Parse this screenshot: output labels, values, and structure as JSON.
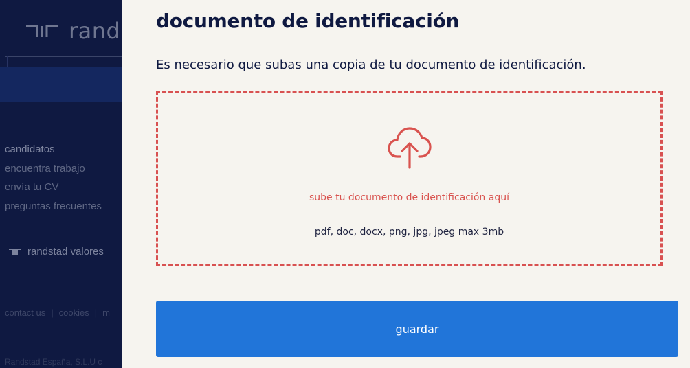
{
  "background": {
    "brand": "rand",
    "nav_heading": "candidatos",
    "nav_items": [
      "encuentra trabajo",
      "envía tu CV",
      "preguntas frecuentes"
    ],
    "valores": "randstad valores",
    "footer_links": [
      "contact us",
      "cookies",
      "m"
    ],
    "copyright": "Randstad España, S.L.U c"
  },
  "modal": {
    "title": "documento de identificación",
    "description": "Es necesario que subas una copia de tu documento de identificación.",
    "dropzone": {
      "icon": "cloud-upload-icon",
      "label": "sube tu documento de identificación aquí",
      "formats": "pdf, doc, docx, png, jpg, jpeg max 3mb"
    },
    "save_label": "guardar"
  },
  "colors": {
    "navy": "#0f1941",
    "accent_red": "#d9534f",
    "button_blue": "#2175d9",
    "panel_bg": "#f6f4ef"
  }
}
